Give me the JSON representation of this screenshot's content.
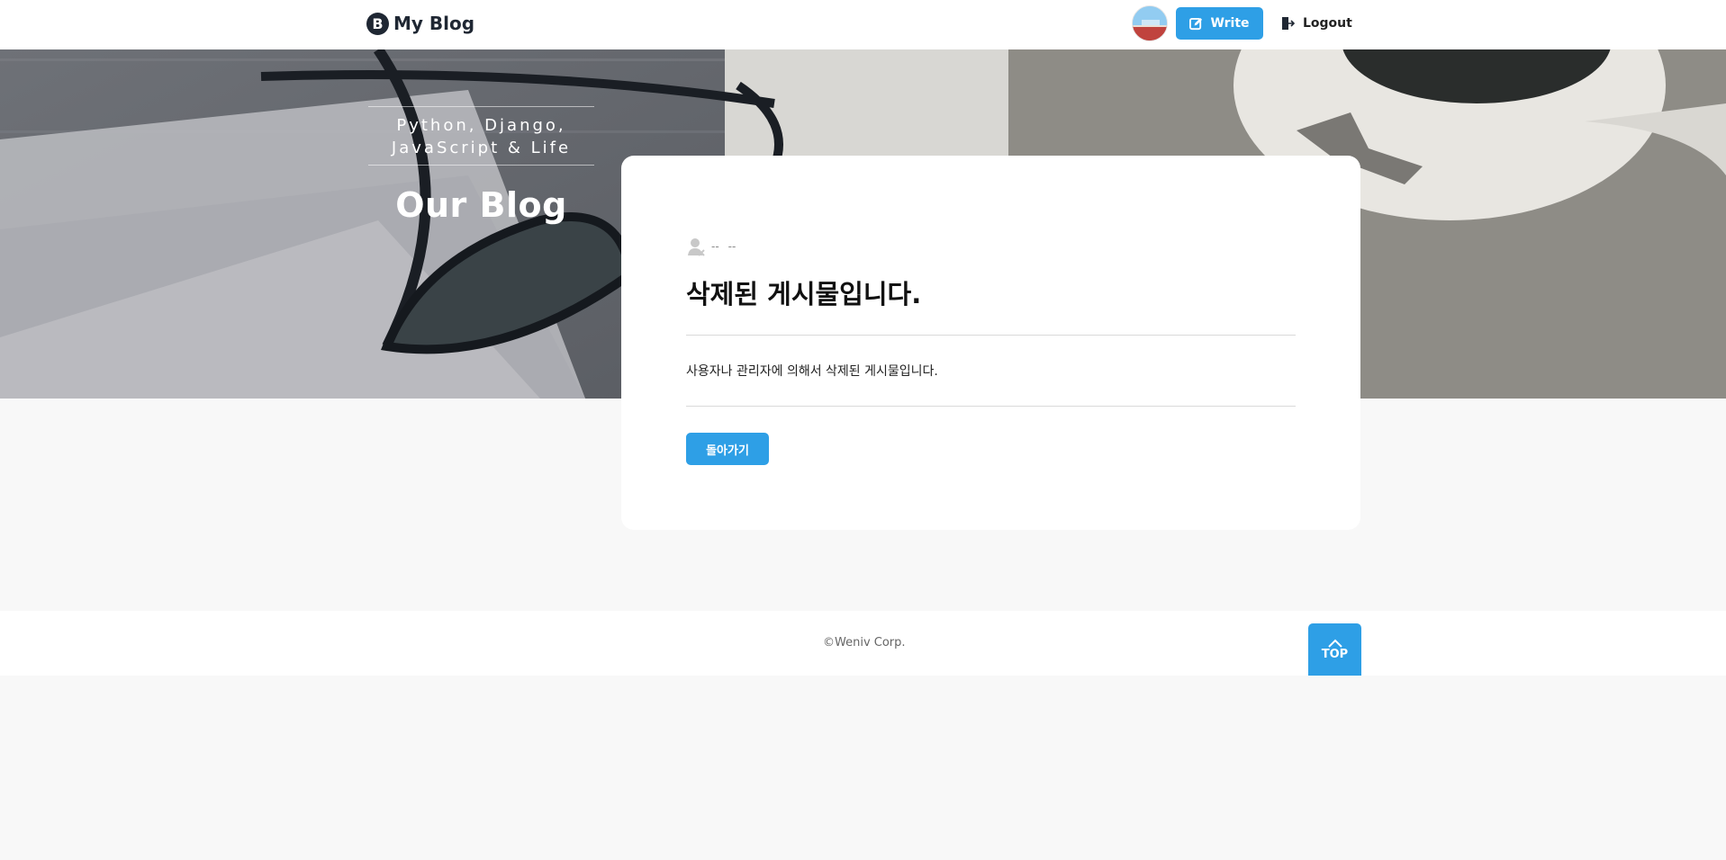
{
  "header": {
    "logo_mark": "B",
    "logo_text": "My Blog",
    "write_label": "Write",
    "logout_label": "Logout"
  },
  "hero": {
    "subtitle_line1": "Python, Django,",
    "subtitle_line2": "JavaScript & Life",
    "title": "Our Blog"
  },
  "post": {
    "author": "--",
    "date": "--",
    "title": "삭제된 게시물입니다.",
    "body": "사용자나 관리자에 의해서 삭제된 게시물입니다.",
    "back_label": "돌아가기"
  },
  "footer": {
    "copyright": "©Weniv Corp.",
    "top_label": "TOP"
  },
  "colors": {
    "accent": "#2e9fe6",
    "dark": "#1f2733",
    "page_bg": "#f8f8f8"
  },
  "icons": {
    "logo": "blog-logo-icon",
    "write": "edit-icon",
    "logout": "logout-icon",
    "author": "deleted-user-icon",
    "top": "chevron-up-icon"
  }
}
